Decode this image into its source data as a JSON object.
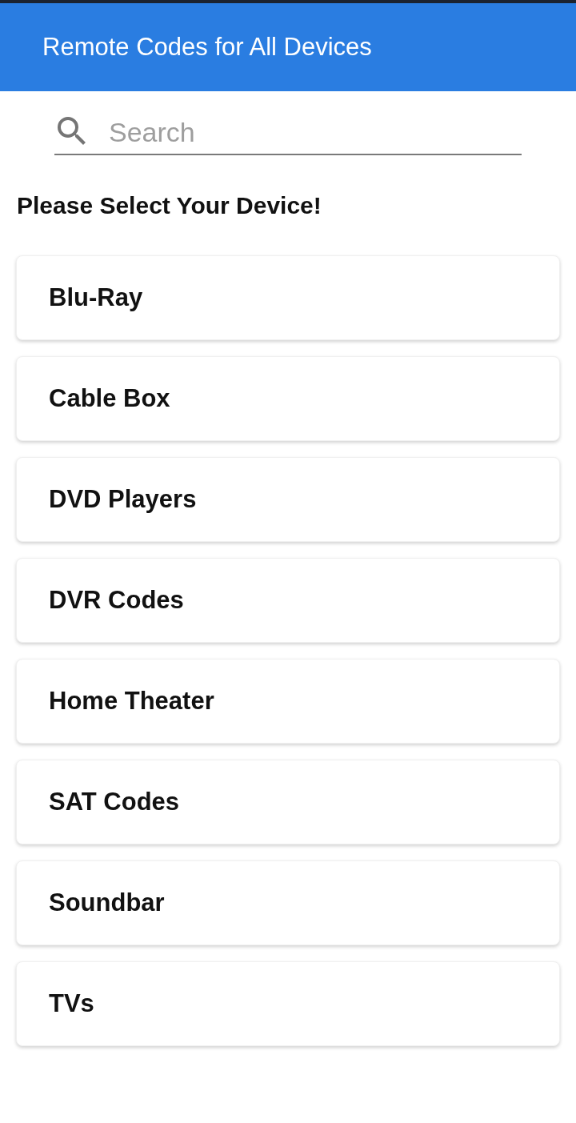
{
  "app_bar": {
    "title": "Remote Codes for All Devices"
  },
  "search": {
    "placeholder": "Search"
  },
  "heading": "Please Select Your Device!",
  "devices": [
    {
      "label": "Blu-Ray"
    },
    {
      "label": "Cable Box"
    },
    {
      "label": "DVD Players"
    },
    {
      "label": "DVR Codes"
    },
    {
      "label": "Home Theater"
    },
    {
      "label": "SAT Codes"
    },
    {
      "label": "Soundbar"
    },
    {
      "label": "TVs"
    }
  ]
}
